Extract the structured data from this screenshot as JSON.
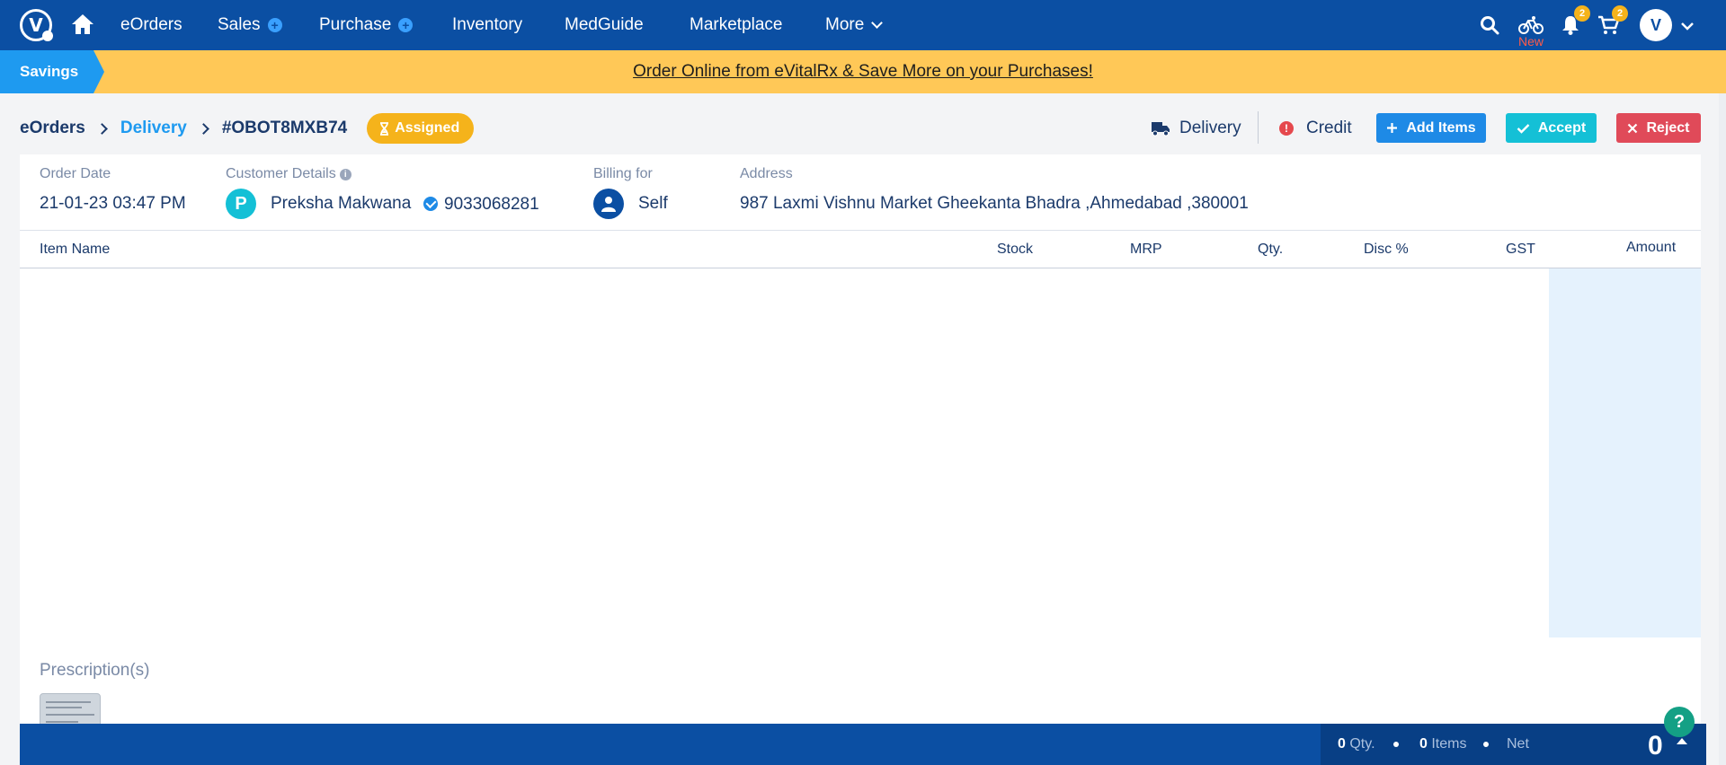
{
  "nav": {
    "logo_letter": "V",
    "items": [
      "eOrders",
      "Sales",
      "Purchase",
      "Inventory",
      "MedGuide",
      "Marketplace",
      "More"
    ],
    "new_label": "New",
    "notification_count": "2",
    "cart_count": "2",
    "avatar_letter": "V"
  },
  "banner": {
    "tag": "Savings",
    "message": "Order Online from eVitalRx & Save More on your Purchases!"
  },
  "breadcrumb": {
    "root": "eOrders",
    "section": "Delivery",
    "order_id": "#OBOT8MXB74",
    "status": "Assigned"
  },
  "actions": {
    "delivery": "Delivery",
    "credit": "Credit",
    "add_items": "Add Items",
    "accept": "Accept",
    "reject": "Reject"
  },
  "order": {
    "date_label": "Order Date",
    "date_value": "21-01-23 03:47 PM",
    "customer_label": "Customer Details",
    "customer_initial": "P",
    "customer_name": "Preksha Makwana",
    "customer_phone": "9033068281",
    "billing_label": "Billing for",
    "billing_value": "Self",
    "address_label": "Address",
    "address_value": "987 Laxmi Vishnu Market Gheekanta Bhadra ,Ahmedabad ,380001"
  },
  "table": {
    "columns": [
      "Item Name",
      "Stock",
      "MRP",
      "Qty.",
      "Disc %",
      "GST",
      "Amount"
    ],
    "rows": []
  },
  "prescription": {
    "label": "Prescription(s)"
  },
  "footer": {
    "qty_value": "0",
    "qty_label": "Qty.",
    "items_value": "0",
    "items_label": "Items",
    "net_label": "Net",
    "total": "0"
  },
  "help_label": "?",
  "colors": {
    "primary": "#0b4fa3",
    "accent": "#1e9af0",
    "banner": "#ffc857",
    "status_assigned": "#f5b31b",
    "accept": "#14c0d6",
    "reject": "#e04a59"
  }
}
